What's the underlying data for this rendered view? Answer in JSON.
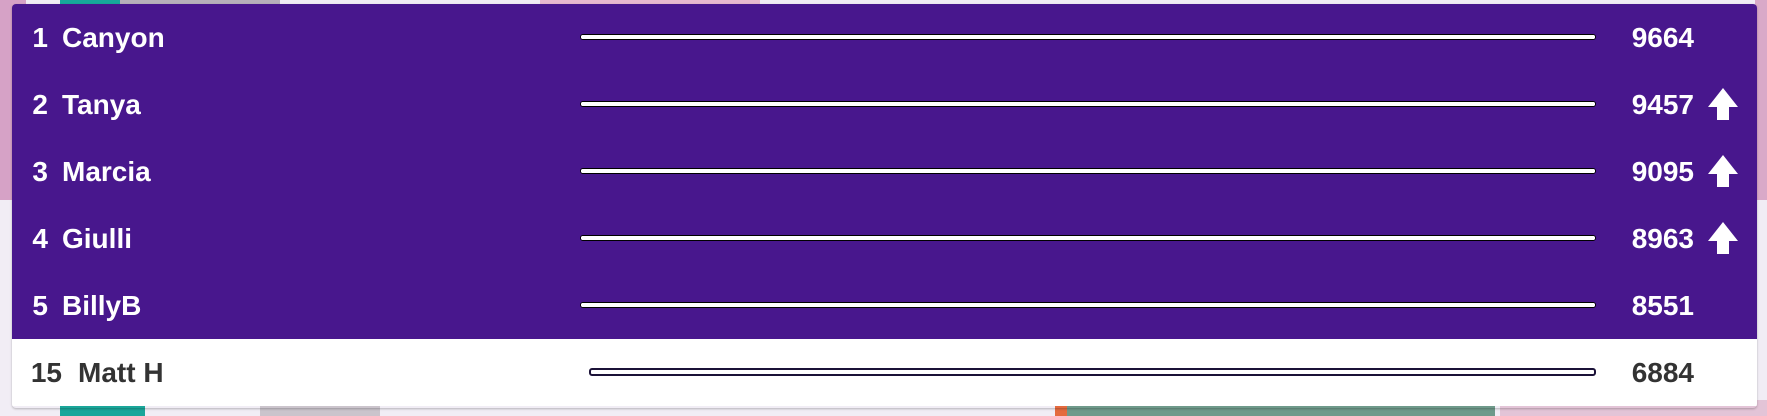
{
  "leaderboard": {
    "rows": [
      {
        "rank": "1",
        "name": "Canyon",
        "score": "9664",
        "trend": "none",
        "progress": 1.0
      },
      {
        "rank": "2",
        "name": "Tanya",
        "score": "9457",
        "trend": "up-arrow-icon",
        "progress": 1.0
      },
      {
        "rank": "3",
        "name": "Marcia",
        "score": "9095",
        "trend": "up-arrow-icon",
        "progress": 1.0
      },
      {
        "rank": "4",
        "name": "Giulli",
        "score": "8963",
        "trend": "up-arrow-icon",
        "progress": 1.0
      },
      {
        "rank": "5",
        "name": "BillyB",
        "score": "8551",
        "trend": "none",
        "progress": 1.0
      }
    ],
    "current_user": {
      "rank": "15",
      "name": "Matt H",
      "score": "6884",
      "trend": "none",
      "progress": 1.0
    }
  },
  "colors": {
    "panel_purple": "#48178d",
    "current_row_bg": "#ffffff",
    "text_light": "#ffffff",
    "text_dark": "#333333"
  }
}
